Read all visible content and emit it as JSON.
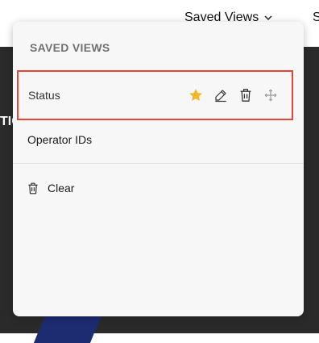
{
  "topbar": {
    "saved_views_label": "Saved Views",
    "next_tab_label": "S"
  },
  "background": {
    "peek_text": "TIO"
  },
  "panel": {
    "title": "SAVED VIEWS",
    "views": [
      {
        "label": "Status",
        "favorite": true,
        "selected": true
      },
      {
        "label": "Operator IDs"
      }
    ],
    "clear_label": "Clear"
  },
  "colors": {
    "star": "#f5b529",
    "highlight_border": "#e0463a",
    "panel_bg": "#f7f7f7"
  }
}
